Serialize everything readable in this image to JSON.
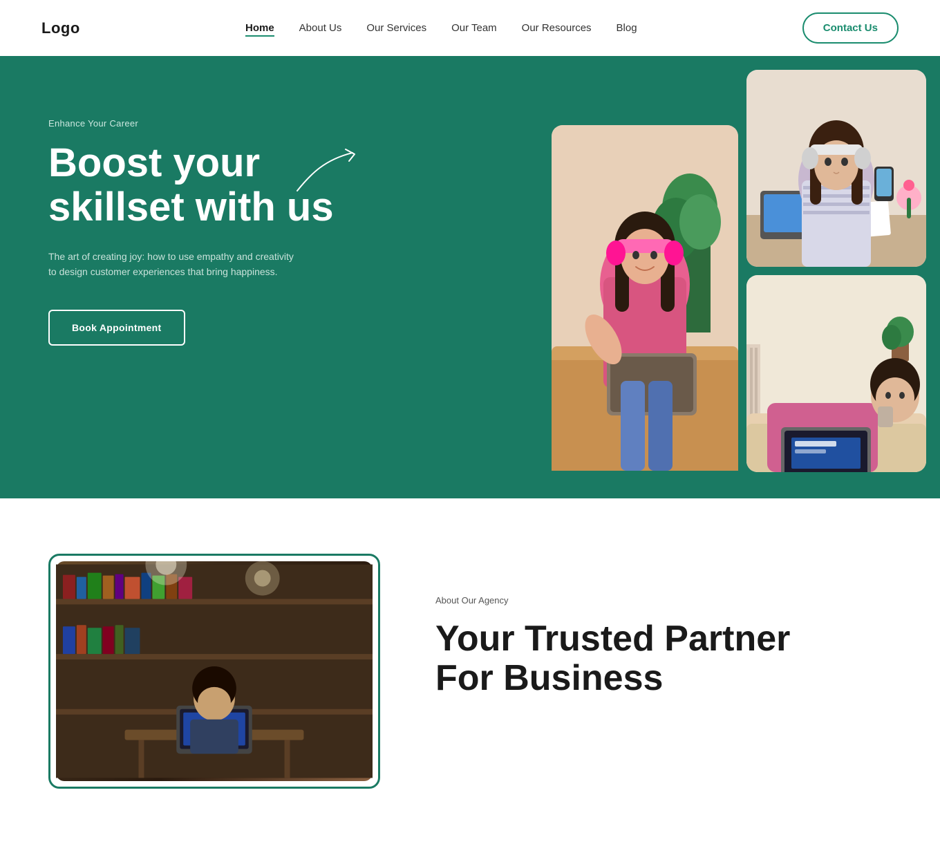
{
  "nav": {
    "logo": "Logo",
    "links": [
      {
        "label": "Home",
        "active": true
      },
      {
        "label": "About Us",
        "active": false
      },
      {
        "label": "Our Services",
        "active": false
      },
      {
        "label": "Our Team",
        "active": false
      },
      {
        "label": "Our Resources",
        "active": false
      },
      {
        "label": "Blog",
        "active": false
      }
    ],
    "contact_btn": "Contact Us"
  },
  "hero": {
    "subtitle": "Enhance Your Career",
    "title": "Boost your skillset with us",
    "description": "The art of creating joy: how to use empathy and creativity to design customer experiences that bring happiness.",
    "book_btn": "Book Appointment",
    "bg_color": "#1a7a63"
  },
  "about": {
    "label": "About Our Agency",
    "title_line1": "Your Trusted Partner",
    "title_line2": "For Business"
  }
}
